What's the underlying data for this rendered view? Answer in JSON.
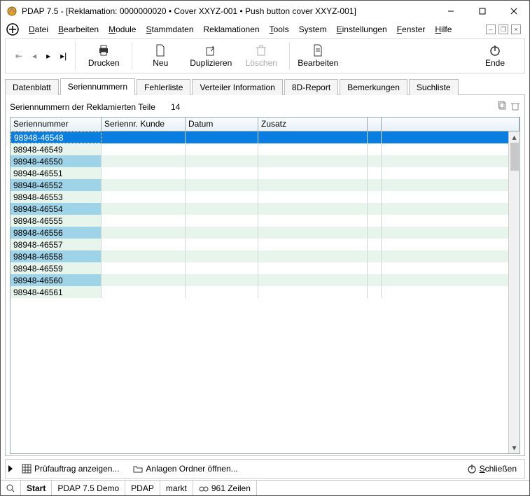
{
  "window": {
    "title": "PDAP 7.5 - [Reklamation:  0000000020 • Cover XXYZ-001 • Push button cover XXYZ-001]"
  },
  "menu": {
    "datei": "Datei",
    "bearbeiten": "Bearbeiten",
    "module": "Module",
    "stammdaten": "Stammdaten",
    "reklamationen": "Reklamationen",
    "tools": "Tools",
    "system": "System",
    "einstellungen": "Einstellungen",
    "fenster": "Fenster",
    "hilfe": "Hilfe"
  },
  "toolbar": {
    "drucken": "Drucken",
    "neu": "Neu",
    "duplizieren": "Duplizieren",
    "loeschen": "Löschen",
    "bearbeiten": "Bearbeiten",
    "ende": "Ende"
  },
  "tabs": {
    "datenblatt": "Datenblatt",
    "seriennummern": "Seriennummern",
    "fehlerliste": "Fehlerliste",
    "verteiler": "Verteiler Information",
    "report": "8D-Report",
    "bemerkungen": "Bemerkungen",
    "suchliste": "Suchliste"
  },
  "subheader": {
    "label": "Seriennummern der Reklamierten Teile",
    "count": "14"
  },
  "columns": {
    "c0": "Seriennummer",
    "c1": "Seriennr. Kunde",
    "c2": "Datum",
    "c3": "Zusatz"
  },
  "rows": [
    {
      "sn": "98948-46548",
      "sel": true
    },
    {
      "sn": "98948-46549"
    },
    {
      "sn": "98948-46550",
      "alt": true
    },
    {
      "sn": "98948-46551"
    },
    {
      "sn": "98948-46552",
      "alt": true
    },
    {
      "sn": "98948-46553"
    },
    {
      "sn": "98948-46554",
      "alt": true
    },
    {
      "sn": "98948-46555"
    },
    {
      "sn": "98948-46556",
      "alt": true
    },
    {
      "sn": "98948-46557"
    },
    {
      "sn": "98948-46558",
      "alt": true
    },
    {
      "sn": "98948-46559"
    },
    {
      "sn": "98948-46560",
      "alt": true
    },
    {
      "sn": "98948-46561"
    }
  ],
  "bottom": {
    "pruef": "Prüfauftrag anzeigen...",
    "anlagen": "Anlagen Ordner öffnen...",
    "schliessen": "Schließen"
  },
  "status": {
    "start": "Start",
    "demo": "PDAP 7.5 Demo",
    "pdap": "PDAP",
    "markt": "markt",
    "zeilen": "961 Zeilen"
  }
}
